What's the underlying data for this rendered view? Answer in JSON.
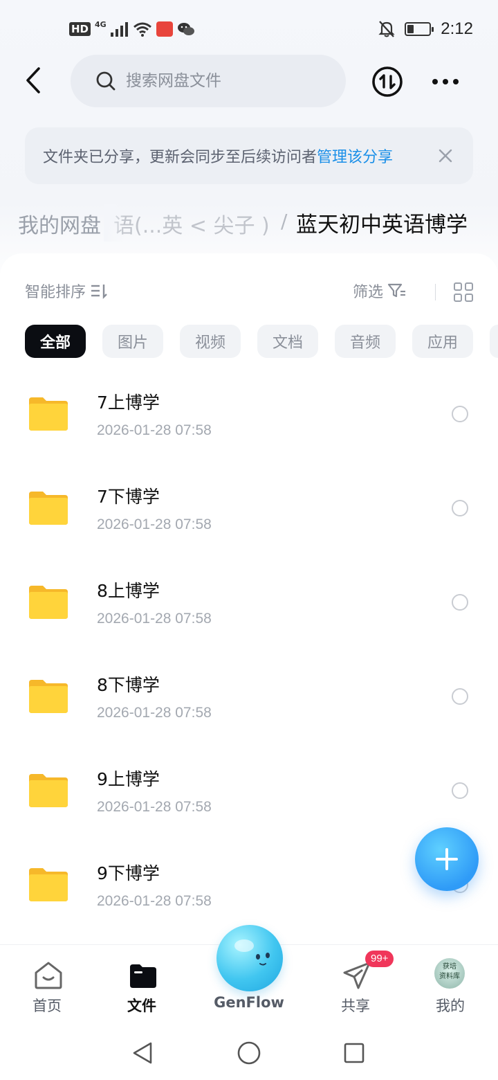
{
  "status_bar": {
    "left_indicators": [
      "HD",
      "4G"
    ],
    "time": "2:12",
    "battery_level": 0.3
  },
  "header": {
    "search_placeholder": "搜索网盘文件"
  },
  "notice": {
    "text": "文件夹已分享，更新会同步至后续访问者",
    "link": "管理该分享"
  },
  "breadcrumb": {
    "root": "我的网盘",
    "middle": "语(...英 < 尖子 )",
    "separator": "/",
    "current": "蓝天初中英语博学"
  },
  "toolbar": {
    "sort_label": "智能排序",
    "filter_label": "筛选"
  },
  "chips": [
    "全部",
    "图片",
    "视频",
    "文档",
    "音频",
    "应用"
  ],
  "files": [
    {
      "name": "7上博学",
      "date": "2026-01-28  07:58"
    },
    {
      "name": "7下博学",
      "date": "2026-01-28  07:58"
    },
    {
      "name": "8上博学",
      "date": "2026-01-28  07:58"
    },
    {
      "name": "8下博学",
      "date": "2026-01-28  07:58"
    },
    {
      "name": "9上博学",
      "date": "2026-01-28  07:58"
    },
    {
      "name": "9下博学",
      "date": "2026-01-28  07:58"
    }
  ],
  "bottom_nav": {
    "home": "首页",
    "files": "文件",
    "genflow": "GenFlow",
    "share": "共享",
    "share_badge": "99+",
    "me": "我的",
    "avatar_text": "获培\n资料库"
  },
  "colors": {
    "accent": "#1a8fe8",
    "badge": "#f0365a",
    "folder": "#ffd43b",
    "active_chip": "#0b0d12"
  }
}
